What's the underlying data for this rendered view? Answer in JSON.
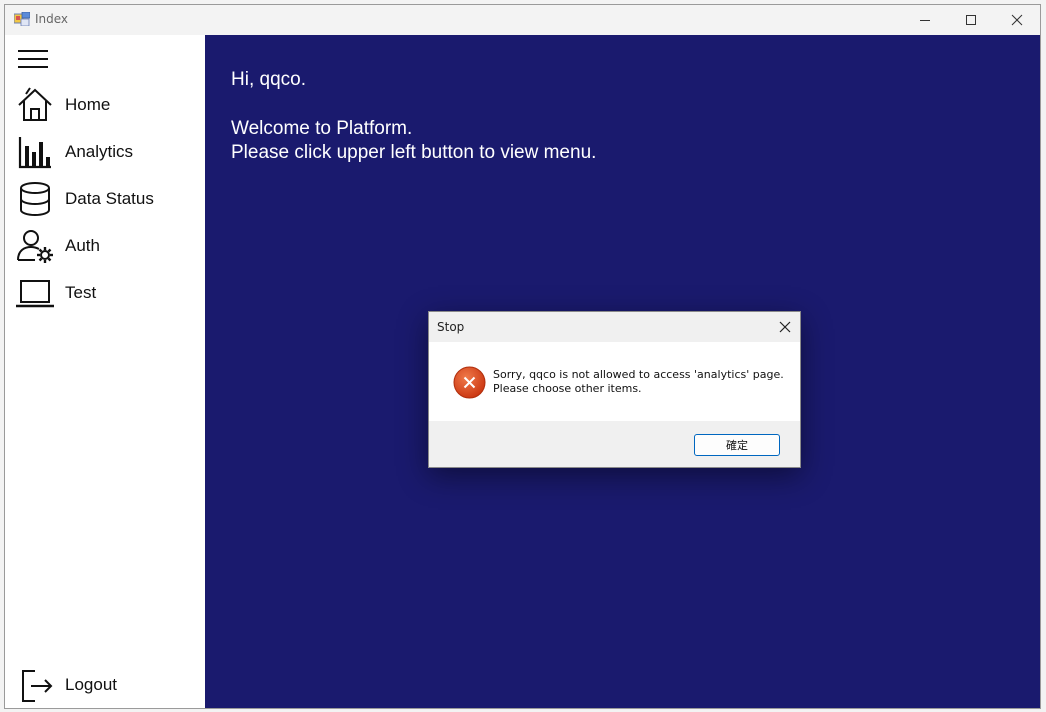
{
  "window": {
    "title": "Index"
  },
  "sidebar": {
    "items": [
      {
        "label": "Home",
        "icon": "home-icon"
      },
      {
        "label": "Analytics",
        "icon": "bar-chart-icon"
      },
      {
        "label": "Data Status",
        "icon": "database-icon"
      },
      {
        "label": "Auth",
        "icon": "user-settings-icon"
      },
      {
        "label": "Test",
        "icon": "laptop-icon"
      }
    ],
    "logout": {
      "label": "Logout",
      "icon": "logout-icon"
    }
  },
  "main": {
    "greeting": "Hi, qqco.",
    "welcome_line1": "Welcome to Platform.",
    "welcome_line2": "Please click upper left button to view menu."
  },
  "dialog": {
    "title": "Stop",
    "message_line1": "Sorry, qqco is not allowed to access 'analytics' page.",
    "message_line2": "Please choose other items.",
    "ok_label": "確定",
    "icon": "error-icon"
  },
  "colors": {
    "main_bg": "#1a1a6e",
    "error_red": "#d8441c",
    "button_border": "#0067c0"
  }
}
